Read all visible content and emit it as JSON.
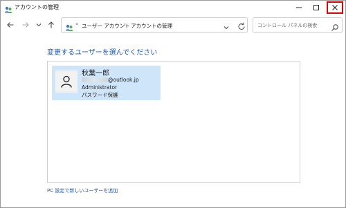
{
  "window": {
    "title": "アカウントの管理"
  },
  "address": {
    "crumb_prefix": "«",
    "crumbs": [
      "ユーザー アカウント",
      "アカウントの管理"
    ],
    "separator": "›"
  },
  "search": {
    "placeholder": "コントロール パネルの検索"
  },
  "main": {
    "heading": "変更するユーザーを選んでください",
    "users": [
      {
        "name": "秋葉一郎",
        "email_domain": "@outlook.jp",
        "role": "Administrator",
        "password_status": "パスワード保護"
      }
    ],
    "add_user_link": "PC 設定で新しいユーザーを追加"
  },
  "colors": {
    "link": "#1e57a8",
    "selected_tile": "#cfe6fa",
    "close_highlight": "#e00000"
  }
}
